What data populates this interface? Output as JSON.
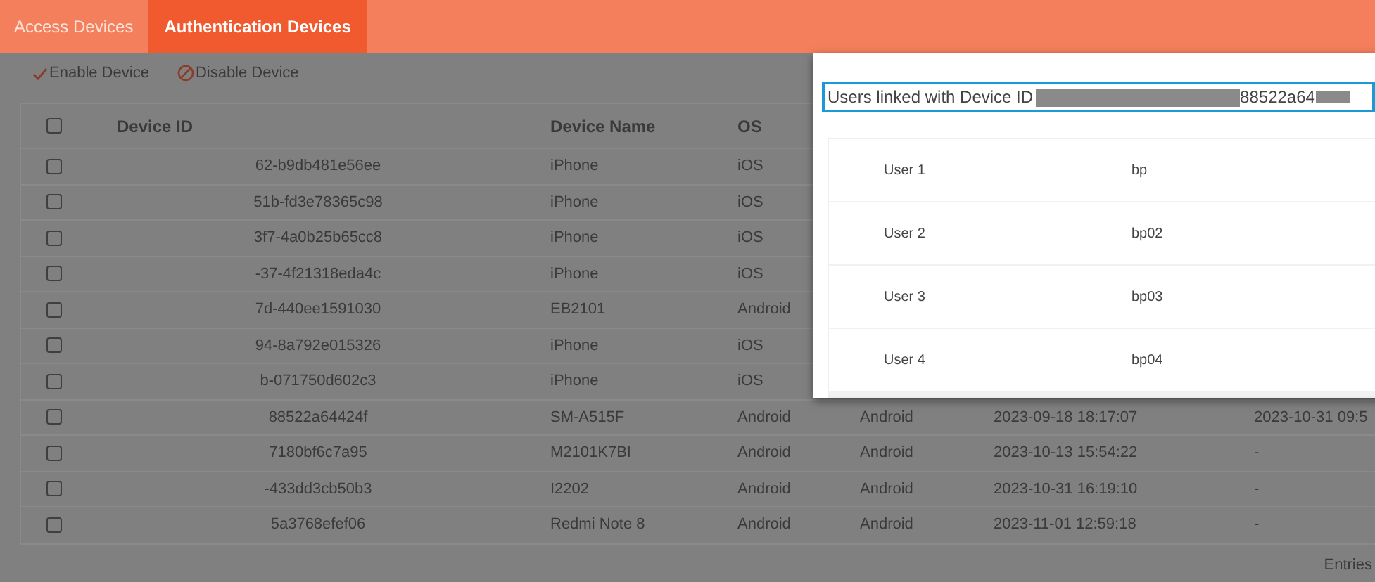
{
  "tabs": [
    {
      "label": "Access Devices",
      "selected": false
    },
    {
      "label": "Authentication Devices",
      "selected": true
    }
  ],
  "toolbar": [
    {
      "kind": "enable",
      "label": "Enable Device"
    },
    {
      "kind": "disable",
      "label": "Disable Device"
    }
  ],
  "table": {
    "select_all": {
      "checked": false
    },
    "columns": [
      "Device ID",
      "Device Name",
      "OS"
    ],
    "rows": [
      {
        "checked": false,
        "cells": [
          "62-b9db481e56ee",
          "iPhone",
          "iOS"
        ]
      },
      {
        "checked": false,
        "cells": [
          "51b-fd3e78365c98",
          "iPhone",
          "iOS"
        ]
      },
      {
        "checked": false,
        "cells": [
          "3f7-4a0b25b65cc8",
          "iPhone",
          "iOS"
        ]
      },
      {
        "checked": false,
        "cells": [
          "-37-4f21318eda4c",
          "iPhone",
          "iOS"
        ]
      },
      {
        "checked": false,
        "cells": [
          "7d-440ee1591030",
          "EB2101",
          "Android"
        ]
      },
      {
        "checked": false,
        "cells": [
          "94-8a792e015326",
          "iPhone",
          "iOS"
        ]
      },
      {
        "checked": false,
        "cells": [
          "b-071750d602c3",
          "iPhone",
          "iOS"
        ]
      },
      {
        "checked": false,
        "cells": [
          "88522a64424f",
          "SM-A515F",
          "Android",
          "Android",
          "2023-09-18 18:17:07",
          "2023-10-31 09:5"
        ]
      },
      {
        "checked": false,
        "cells": [
          "7180bf6c7a95",
          "M2101K7BI",
          "Android",
          "Android",
          "2023-10-13 15:54:22",
          "-"
        ]
      },
      {
        "checked": false,
        "cells": [
          "-433dd3cb50b3",
          "I2202",
          "Android",
          "Android",
          "2023-10-31 16:19:10",
          "-"
        ]
      },
      {
        "checked": false,
        "cells": [
          "5a3768efef06",
          "Redmi Note 8",
          "Android",
          "Android",
          "2023-11-01 12:59:18",
          "-"
        ]
      }
    ]
  },
  "footer": {
    "entries_label": "Entries"
  },
  "popup": {
    "title": "Users linked with Device ID",
    "device_id_fragment": "88522a64",
    "users": [
      {
        "label": "User 1",
        "value": "bp"
      },
      {
        "label": "User 2",
        "value": "bp02"
      },
      {
        "label": "User 3",
        "value": "bp03"
      },
      {
        "label": "User 4",
        "value": "bp04"
      }
    ]
  }
}
